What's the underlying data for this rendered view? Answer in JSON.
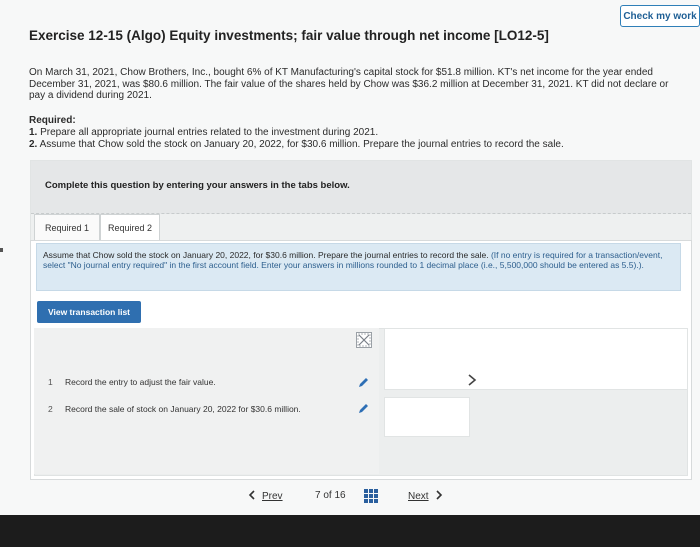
{
  "header": {
    "check_label": "Check my work",
    "title": "Exercise 12-15 (Algo) Equity investments; fair value through net income [LO12-5]"
  },
  "problem": {
    "intro": "On March 31, 2021, Chow Brothers, Inc., bought 6% of KT Manufacturing's capital stock for $51.8 million. KT's net income for the year ended December 31, 2021, was $80.6 million. The fair value of the shares held by Chow was $36.2 million at December 31, 2021. KT did not declare or pay a dividend during 2021.",
    "required_heading": "Required:",
    "req1_num": "1.",
    "req1_text": "Prepare all appropriate journal entries related to the investment during 2021.",
    "req2_num": "2.",
    "req2_text": "Assume that Chow sold the stock on January 20, 2022, for $30.6 million. Prepare the journal entries to record the sale."
  },
  "panel": {
    "heading": "Complete this question by entering your answers in the tabs below.",
    "tabs": [
      {
        "label": "Required 1"
      },
      {
        "label": "Required 2"
      }
    ],
    "instructions_main": "Assume that Chow sold the stock on January 20, 2022, for $30.6 million. Prepare the journal entries to record the sale.",
    "instructions_note": "(If no entry is required for a transaction/event, select \"No journal entry required\" in the first account field. Enter your answers in millions rounded to 1 decimal place (i.e., 5,500,000 should be entered as 5.5).).",
    "view_button": "View transaction list",
    "entries": [
      {
        "num": "1",
        "text": "Record the entry to adjust the fair value."
      },
      {
        "num": "2",
        "text": "Record the sale of stock on January 20, 2022 for $30.6 million."
      }
    ]
  },
  "pagination": {
    "prev": "Prev",
    "page": "7 of 16",
    "next": "Next"
  },
  "colors": {
    "accent": "#2f6fb0",
    "instruction_bg": "#dbe9f3",
    "bottom_bar": "#1c1c1c"
  },
  "icons": [
    "pencil-icon",
    "broken-image-icon",
    "chevron-right-icon",
    "grid-icon",
    "chevron-left-icon"
  ]
}
